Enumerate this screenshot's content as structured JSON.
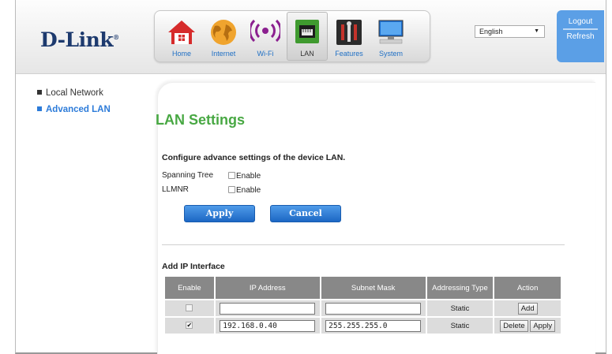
{
  "brand": {
    "logo": "D-Link",
    "trademark": "®"
  },
  "nav": {
    "items": [
      {
        "label": "Home",
        "icon": "home-icon"
      },
      {
        "label": "Internet",
        "icon": "globe-icon"
      },
      {
        "label": "Wi-Fi",
        "icon": "wifi-icon"
      },
      {
        "label": "LAN",
        "icon": "lan-icon",
        "active": true
      },
      {
        "label": "Features",
        "icon": "tools-icon"
      },
      {
        "label": "System",
        "icon": "computer-icon"
      }
    ]
  },
  "language": {
    "selected": "English",
    "arrow": "▼"
  },
  "account": {
    "logout": "Logout",
    "refresh": "Refresh"
  },
  "sidebar": {
    "items": [
      {
        "label": "Local Network",
        "selected": false
      },
      {
        "label": "Advanced LAN",
        "selected": true
      }
    ]
  },
  "page": {
    "title": "LAN Settings",
    "description": "Configure advance settings of the device LAN.",
    "options": [
      {
        "label": "Spanning Tree",
        "checkbox_label": "Enable",
        "checked": false
      },
      {
        "label": "LLMNR",
        "checkbox_label": "Enable",
        "checked": false
      }
    ],
    "apply_label": "Apply",
    "cancel_label": "Cancel"
  },
  "ip_interface": {
    "heading": "Add IP Interface",
    "columns": [
      "Enable",
      "IP Address",
      "Subnet Mask",
      "Addressing Type",
      "Action"
    ],
    "rows": [
      {
        "enabled": false,
        "ip": "",
        "mask": "",
        "type": "Static",
        "actions": [
          "Add"
        ]
      },
      {
        "enabled": true,
        "ip": "192.168.0.40",
        "mask": "255.255.255.0",
        "type": "Static",
        "actions": [
          "Delete",
          "Apply"
        ]
      }
    ]
  },
  "colors": {
    "accent_blue": "#2c7bd9",
    "title_green": "#48a843",
    "account_panel": "#5b9fe6",
    "table_header": "#888888"
  }
}
